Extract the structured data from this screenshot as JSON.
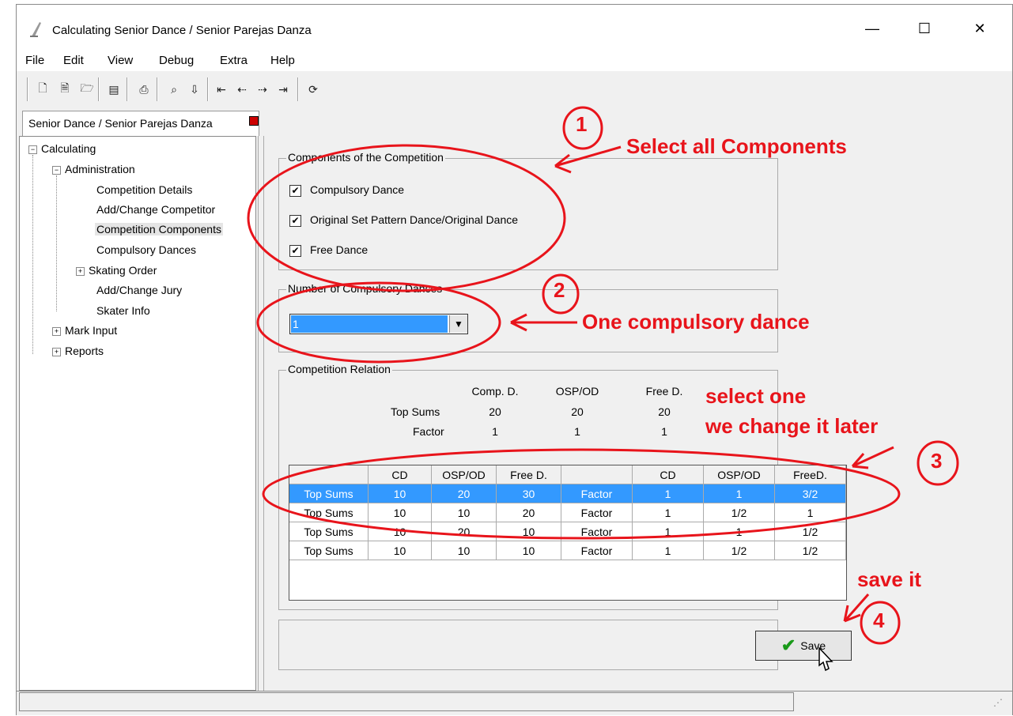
{
  "window": {
    "title": "Calculating  Senior Dance / Senior Parejas Danza",
    "minimize": "—",
    "maximize": "☐",
    "close": "✕"
  },
  "menu": [
    "File",
    "Edit",
    "View",
    "Debug",
    "Extra",
    "Help"
  ],
  "tab": {
    "label": "Senior Dance / Senior Parejas Danza"
  },
  "tree": {
    "root": "Calculating",
    "administration": "Administration",
    "items": [
      "Competition Details",
      "Add/Change Competitor",
      "Competition Components",
      "Compulsory Dances",
      "Skating Order",
      "Add/Change Jury",
      "Skater Info"
    ],
    "mark_input": "Mark Input",
    "reports": "Reports"
  },
  "components": {
    "label": "Components of the Competition",
    "items": [
      "Compulsory Dance",
      "Original Set Pattern Dance/Original Dance",
      "Free Dance"
    ]
  },
  "compulsory": {
    "label": "Number of Compulsory Dances",
    "value": "1"
  },
  "relation": {
    "label": "Competition Relation",
    "headers": [
      "Comp. D.",
      "OSP/OD",
      "Free D."
    ],
    "top_sums_label": "Top Sums",
    "top_sums": [
      "20",
      "20",
      "20"
    ],
    "factor_label": "Factor",
    "factor": [
      "1",
      "1",
      "1"
    ]
  },
  "grid": {
    "headers": [
      "",
      "CD",
      "OSP/OD",
      "Free D.",
      "",
      "CD",
      "OSP/OD",
      "FreeD."
    ],
    "rows": [
      [
        "Top Sums",
        "10",
        "20",
        "30",
        "Factor",
        "1",
        "1",
        "3/2"
      ],
      [
        "Top Sums",
        "10",
        "10",
        "20",
        "Factor",
        "1",
        "1/2",
        "1"
      ],
      [
        "Top Sums",
        "10",
        "20",
        "10",
        "Factor",
        "1",
        "1",
        "1/2"
      ],
      [
        "Top Sums",
        "10",
        "10",
        "10",
        "Factor",
        "1",
        "1/2",
        "1/2"
      ]
    ]
  },
  "save": {
    "label": "Save"
  },
  "annotations": {
    "n1": "1",
    "t1": "Select all Components",
    "n2": "2",
    "t2": "One compulsory dance",
    "n3": "3",
    "t3a": "select one",
    "t3b": "we change it later",
    "n4": "4",
    "t4": "save it"
  },
  "colors": {
    "annotation": "#e8141b",
    "selection": "#3399ff",
    "check": "#1a9a1a"
  }
}
